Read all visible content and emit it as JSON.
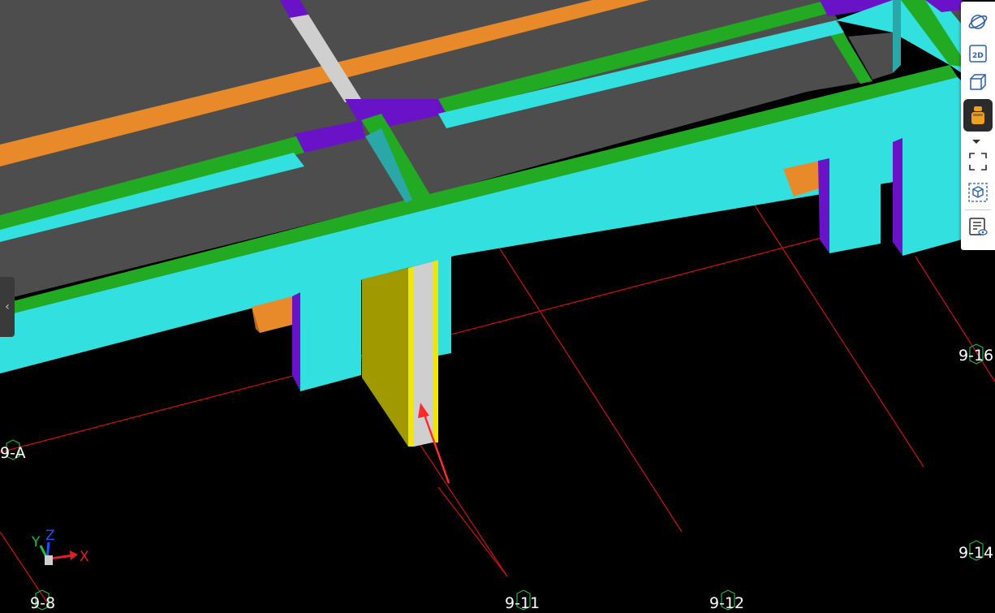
{
  "grid": {
    "labels": {
      "a": "9-A",
      "col_8": "9-8",
      "col_11": "9-11",
      "col_12": "9-12",
      "col_14": "9-14",
      "col_16": "9-16"
    },
    "line_color": "#d01010",
    "marker_color": "#22b34a"
  },
  "axes": {
    "x_label": "X",
    "y_label": "Y",
    "z_label": "Z",
    "x_color": "#e02020",
    "y_color": "#20c040",
    "z_color": "#2050ff"
  },
  "colors": {
    "background": "#000000",
    "slab": "#4d4d4d",
    "beam_cyan": "#33e0e0",
    "beam_green": "#22aa22",
    "beam_orange": "#e88a2a",
    "beam_purple": "#6a12c8",
    "column_yellow": "#a09a00",
    "column_grey": "#cfcfcf",
    "selection_arrow": "#ff2a2a"
  },
  "toolbar": {
    "buttons": [
      {
        "id": "orbit",
        "icon": "orbit-icon",
        "active": false
      },
      {
        "id": "view-2d",
        "icon": "view-2d-icon",
        "label": "2D",
        "active": false
      },
      {
        "id": "view-3d",
        "icon": "cube-icon",
        "active": false
      },
      {
        "id": "walk",
        "icon": "walk-mode-icon",
        "active": true
      },
      {
        "id": "fit",
        "icon": "fit-view-icon",
        "active": false
      },
      {
        "id": "section",
        "icon": "section-box-icon",
        "active": false
      },
      {
        "id": "properties",
        "icon": "properties-icon",
        "active": false
      }
    ],
    "view_2d_label": "2D"
  },
  "collapse_handle": {
    "icon": "chevron-left-icon",
    "glyph": "‹"
  }
}
